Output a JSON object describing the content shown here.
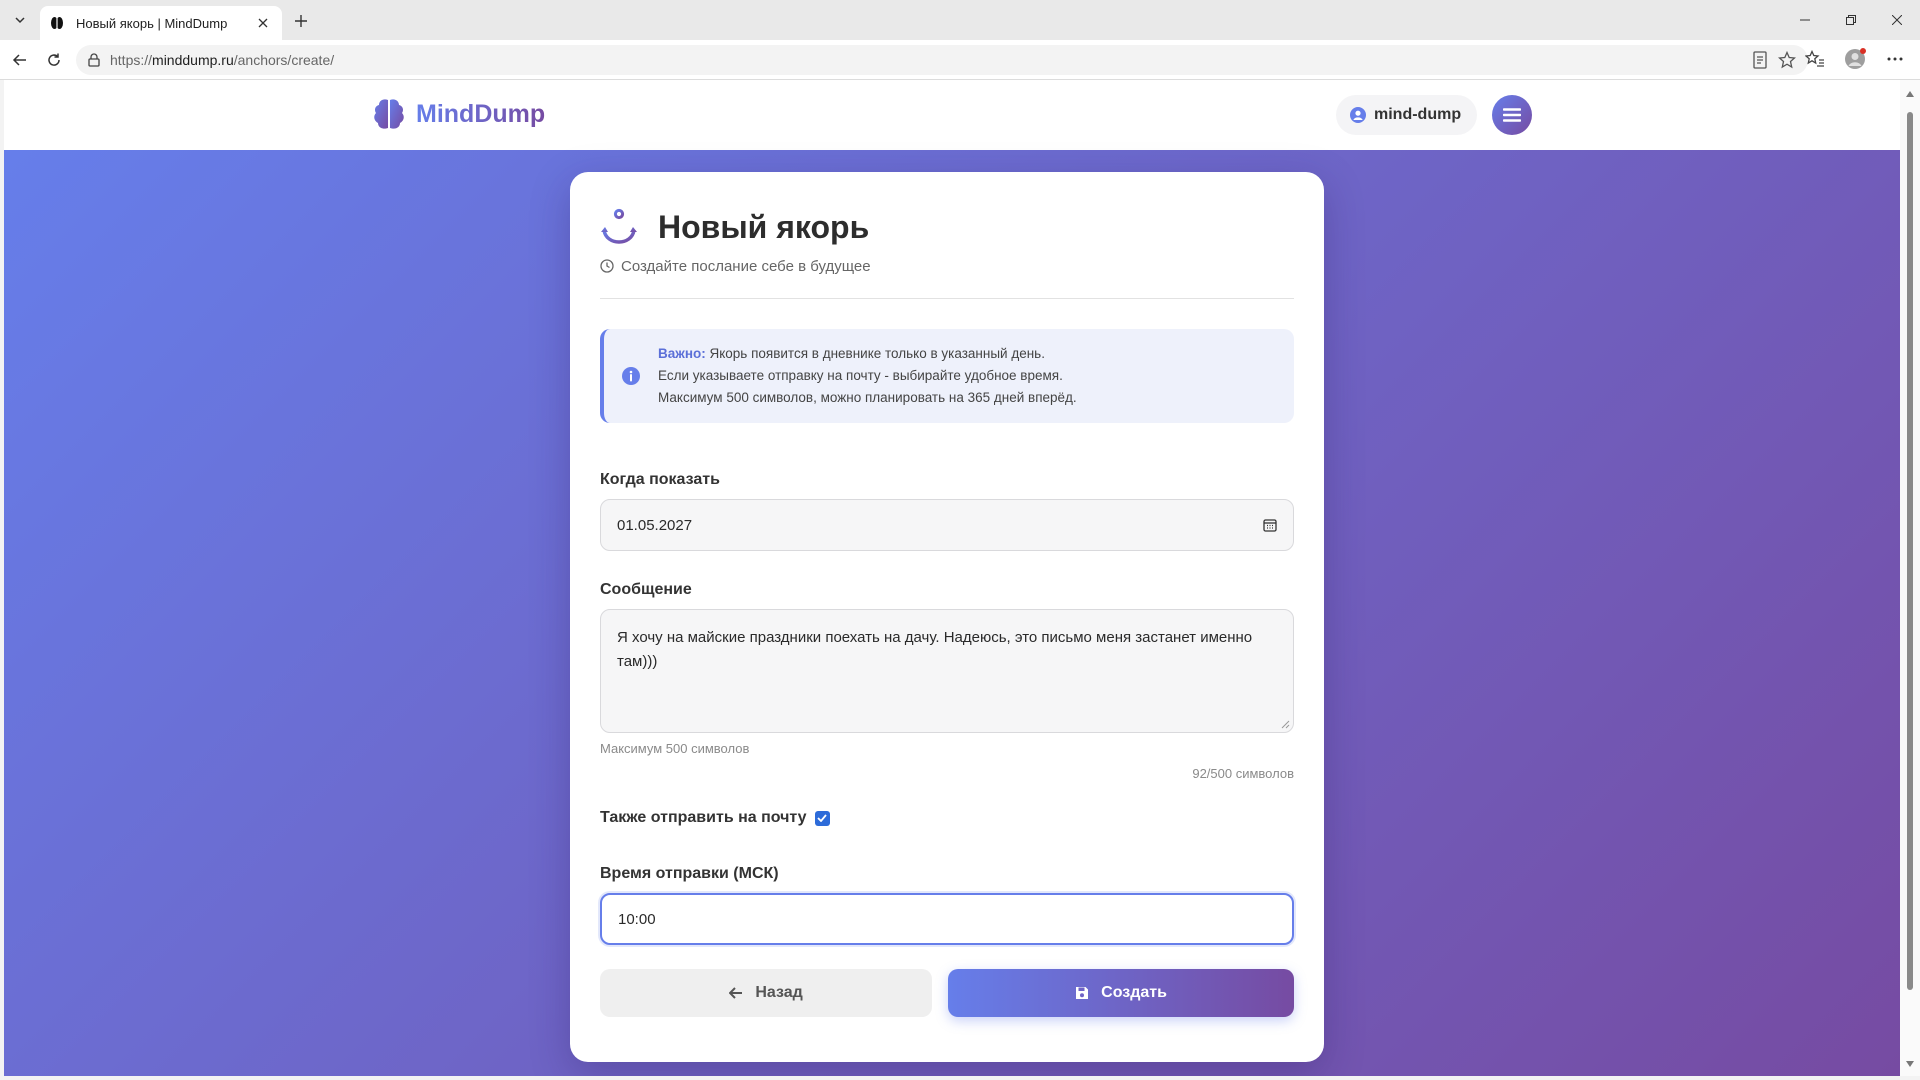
{
  "browser": {
    "tab_title": "Новый якорь | MindDump",
    "url_prefix": "https://",
    "url_host": "minddump.ru",
    "url_path": "/anchors/create/"
  },
  "header": {
    "logo_text": "MindDump",
    "username": "mind-dump"
  },
  "form": {
    "title": "Новый якорь",
    "subtitle": "Создайте послание себе в будущее",
    "alert": {
      "strong": "Важно:",
      "line1": " Якорь появится в дневнике только в указанный день.",
      "line2": "Если указываете отправку на почту - выбирайте удобное время.",
      "line3": "Максимум 500 символов, можно планировать на 365 дней вперёд."
    },
    "date_label": "Когда показать",
    "date_value": "01.05.2027",
    "message_label": "Сообщение",
    "message_value": "Я хочу на майские праздники поехать на дачу. Надеюсь, это письмо меня застанет именно там)))",
    "message_hint": "Максимум 500 символов",
    "char_counter": "92/500 символов",
    "email_checkbox_label": "Также отправить на почту",
    "email_checked": true,
    "time_label": "Время отправки (МСК)",
    "time_value": "10:00",
    "back_label": "Назад",
    "create_label": "Создать"
  },
  "colors": {
    "gradient_start": "#667eea",
    "gradient_end": "#764ba2",
    "checkbox": "#2d6bd9"
  }
}
